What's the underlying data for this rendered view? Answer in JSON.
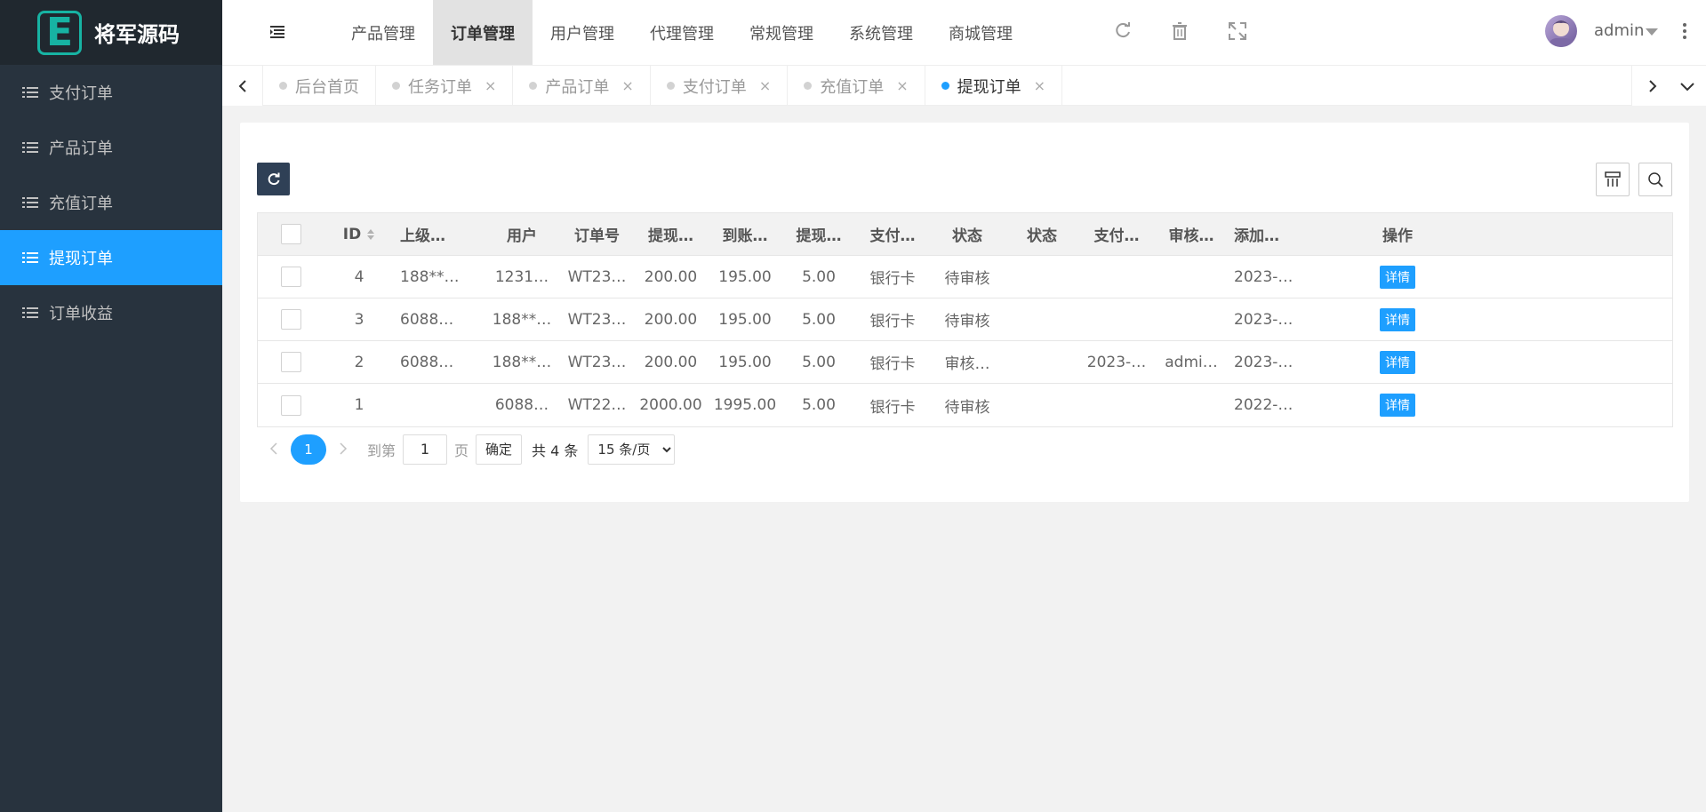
{
  "sidebar": {
    "logo_letter": "E",
    "logo_text": "将军源码",
    "items": [
      {
        "label": "支付订单",
        "active": false
      },
      {
        "label": "产品订单",
        "active": false
      },
      {
        "label": "充值订单",
        "active": false
      },
      {
        "label": "提现订单",
        "active": true
      },
      {
        "label": "订单收益",
        "active": false
      }
    ]
  },
  "header": {
    "menu": [
      "产品管理",
      "订单管理",
      "用户管理",
      "代理管理",
      "常规管理",
      "系统管理",
      "商城管理"
    ],
    "active_menu": "订单管理",
    "icons": [
      "refresh-icon",
      "trash-icon",
      "fullscreen-icon"
    ],
    "username": "admin"
  },
  "tabs": [
    {
      "label": "后台首页",
      "closable": false,
      "active": false
    },
    {
      "label": "任务订单",
      "closable": true,
      "active": false
    },
    {
      "label": "产品订单",
      "closable": true,
      "active": false
    },
    {
      "label": "支付订单",
      "closable": true,
      "active": false
    },
    {
      "label": "充值订单",
      "closable": true,
      "active": false
    },
    {
      "label": "提现订单",
      "closable": true,
      "active": true
    }
  ],
  "tab_close_glyph": "×",
  "table": {
    "columns": [
      "ID",
      "上级…",
      "用户",
      "订单号",
      "提现…",
      "到账…",
      "提现…",
      "支付…",
      "状态",
      "状态",
      "支付…",
      "审核…",
      "添加…",
      "操作"
    ],
    "rows": [
      [
        "4",
        "188**…",
        "1231…",
        "WT23…",
        "200.00",
        "195.00",
        "5.00",
        "银行卡",
        "待审核",
        "",
        "",
        "",
        "2023-…",
        "详情"
      ],
      [
        "3",
        "6088…",
        "188**…",
        "WT23…",
        "200.00",
        "195.00",
        "5.00",
        "银行卡",
        "待审核",
        "",
        "",
        "",
        "2023-…",
        "详情"
      ],
      [
        "2",
        "6088…",
        "188**…",
        "WT23…",
        "200.00",
        "195.00",
        "5.00",
        "银行卡",
        "审核…",
        "",
        "2023-…",
        "admi…",
        "2023-…",
        "详情"
      ],
      [
        "1",
        "",
        "6088…",
        "WT22…",
        "2000.00",
        "1995.00",
        "5.00",
        "银行卡",
        "待审核",
        "",
        "",
        "",
        "2022-…",
        "详情"
      ]
    ]
  },
  "pagination": {
    "current_page": "1",
    "goto_label": "到第",
    "page_input": "1",
    "page_suffix": "页",
    "confirm_label": "确定",
    "total_text": "共 4 条",
    "page_size": "15 条/页"
  },
  "colors": {
    "sidebar_bg": "#28333e",
    "accent": "#1e9fff",
    "logo_teal": "#17b3a3"
  }
}
